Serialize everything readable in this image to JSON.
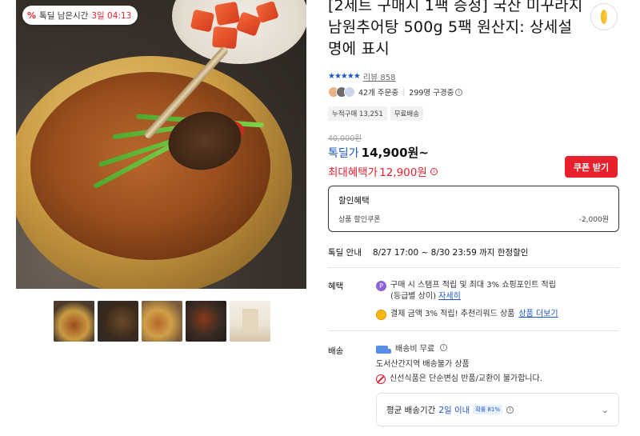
{
  "badge": {
    "icon": "percent-icon",
    "label": "톡딜 남은시간",
    "remaining": "3일 04:13"
  },
  "thumbnails": [
    {
      "name": "thumb-1",
      "selected": true
    },
    {
      "name": "thumb-2",
      "selected": false
    },
    {
      "name": "thumb-3",
      "selected": false
    },
    {
      "name": "thumb-4",
      "selected": false
    },
    {
      "name": "thumb-5",
      "selected": false
    }
  ],
  "product": {
    "title": "[2세트 구매시 1팩 증정] 국산 미꾸라지 남원추어탕 500g 5팩 원산지: 상세설명에 표시",
    "review_label": "리뷰",
    "review_count": "858",
    "orders_text": "42개 주문중",
    "watching_text": "299명 구경중"
  },
  "chips": [
    "누적구매 13,251",
    "무료배송"
  ],
  "price": {
    "original": "40,000원",
    "deal_label": "톡딜가",
    "deal_price": "14,900원~",
    "max_label": "최대혜택가",
    "max_price": "12,900원"
  },
  "coupon_button": "쿠폰 받기",
  "discount": {
    "heading": "할인혜택",
    "item_label": "상품 할인쿠폰",
    "item_value": "-2,000원"
  },
  "deal_info": {
    "label": "톡딜 안내",
    "text": "8/27 17:00 ~ 8/30 23:59 까지 한정할인"
  },
  "benefits": {
    "label": "혜택",
    "line1": "구매 시 스탬프 적립 및 최대 3% 쇼핑포인트 적립",
    "line1b": "(등급별 상이)",
    "line1_link": "자세히",
    "line2": "결제 금액 3% 적립! 추천리워드 상품",
    "line2_link": "상품 더보기"
  },
  "shipping": {
    "label": "배송",
    "fee": "배송비 무료",
    "note": "도서산간지역 배송불가 상품",
    "fresh_note": "신선식품은 단순변심 반품/교환이 불가합니다.",
    "avg_label": "평균 배송기간",
    "avg_days": "2일 이내",
    "avg_badge": "확률 81%"
  },
  "colors": {
    "accent_red": "#e8202c",
    "accent_blue": "#1b57c9"
  }
}
